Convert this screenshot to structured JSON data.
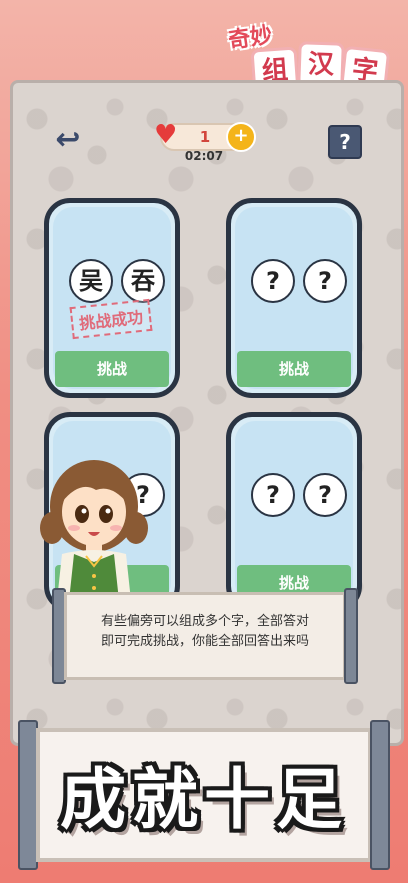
{
  "title": {
    "line1": "奇妙",
    "tiles": [
      "组",
      "汉",
      "字"
    ]
  },
  "header": {
    "lives": "1",
    "timer": "02:07",
    "help_label": "?"
  },
  "cards": [
    {
      "chars": [
        "吴",
        "吞"
      ],
      "status": "挑战成功",
      "button": "挑战"
    },
    {
      "chars": [
        "?",
        "?"
      ],
      "status": "",
      "button": "挑战"
    },
    {
      "chars": [
        "?",
        "?"
      ],
      "status": "",
      "button": ""
    },
    {
      "chars": [
        "?",
        "?"
      ],
      "status": "",
      "button": "挑战"
    }
  ],
  "dialog": {
    "line1": "有些偏旁可以组成多个字，全部答对",
    "line2": "即可完成挑战，你能全部回答出来吗"
  },
  "banner": {
    "slogan": "成就十足"
  },
  "colors": {
    "accent_red": "#e34a5a",
    "button_green": "#6fbe7f",
    "card_blue": "#c7e3f3"
  }
}
